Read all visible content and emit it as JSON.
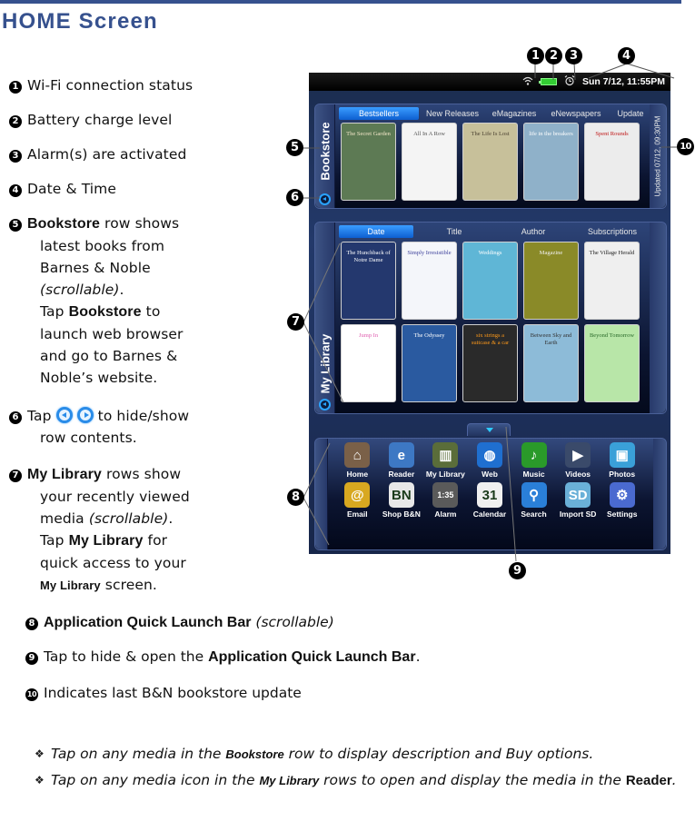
{
  "page": {
    "title": "HOME Screen"
  },
  "legend": [
    {
      "num": "1",
      "text": "Wi-Fi connection status"
    },
    {
      "num": "2",
      "text": "Battery charge level"
    },
    {
      "num": "3",
      "text": "Alarm(s) are activated"
    },
    {
      "num": "4",
      "text": "Date & Time"
    },
    {
      "num": "5",
      "bold": "Bookstore",
      "text": " row shows",
      "lines": [
        "latest books from",
        "Barnes & Noble"
      ],
      "italic": "(scrollable)",
      "after_italic": ".",
      "tap_prefix": "Tap ",
      "tap_bold": "Bookstore",
      "tap_suffix": " to",
      "tap_lines": [
        "launch web browser",
        "and go to Barnes &",
        "Noble’s website."
      ]
    },
    {
      "num": "6",
      "prefix": "Tap ",
      "suffix": " to hide/show",
      "line2": "row contents.",
      "icons": [
        "collapse-left-icon",
        "expand-right-icon"
      ]
    },
    {
      "num": "7",
      "bold": "My Library",
      "text": " rows show",
      "line2": "your recently viewed",
      "line3_prefix": "media ",
      "line3_italic": "(scrollable)",
      "line3_suffix": ".",
      "tap_prefix": "Tap ",
      "tap_bold": "My Library",
      "tap_suffix": " for",
      "line5": "quick access to your",
      "line6_bold": "My Library",
      "line6_suffix": " screen."
    },
    {
      "num": "8",
      "bold": "Application Quick Launch Bar",
      "italic": " (scrollable)"
    },
    {
      "num": "9",
      "prefix": "Tap to hide & open the ",
      "bold": "Application Quick Launch Bar",
      "suffix": "."
    },
    {
      "num": "10",
      "text": "Indicates last B&N bookstore update"
    }
  ],
  "tips": [
    {
      "prefix": "Tap on any media in the ",
      "bold": "Bookstore",
      "suffix": " row to display description and Buy options."
    },
    {
      "prefix": "Tap on any media icon in the ",
      "bold": "My Library",
      "suffix": " rows to open and display the media in the ",
      "bold2": "Reader",
      "end": "."
    }
  ],
  "device": {
    "status_bar": {
      "icons": [
        "wifi-icon",
        "battery-icon",
        "alarm-icon"
      ],
      "datetime": "Sun 7/12, 11:55PM"
    },
    "bookstore": {
      "side_label": "Bookstore",
      "tabs": [
        "Bestsellers",
        "New Releases",
        "eMagazines",
        "eNewspapers",
        "Update"
      ],
      "active_tab": "Bestsellers",
      "updated_label": "Updated 07/12, 09:30PM",
      "covers": [
        {
          "title": "The Secret Garden",
          "bg": "#5d7a54",
          "fg": "#f3e6c8"
        },
        {
          "title": "All In A Row",
          "bg": "#f4f4f4",
          "fg": "#555555"
        },
        {
          "title": "The Life Is Lost",
          "bg": "#c7c09a",
          "fg": "#4a4030"
        },
        {
          "title": "life in the breakers",
          "bg": "#8fb1c9",
          "fg": "#ffffff"
        },
        {
          "title": "Spent Rounds",
          "bg": "#ececec",
          "fg": "#c01818"
        }
      ]
    },
    "library": {
      "side_label": "My Library",
      "tabs": [
        "Date",
        "Title",
        "Author",
        "Subscriptions"
      ],
      "active_tab": "Date",
      "row1": [
        {
          "title": "The Hunchback of Notre Dame",
          "bg": "#24386e",
          "fg": "#ffffff"
        },
        {
          "title": "Simply Irresistible",
          "bg": "#f4f6fa",
          "fg": "#3b3f9a"
        },
        {
          "title": "Weddings",
          "bg": "#5fb6d6",
          "fg": "#ffffff"
        },
        {
          "title": "Magazine",
          "bg": "#8a8a28",
          "fg": "#f0f0f0"
        },
        {
          "title": "The Village Herald",
          "bg": "#efefef",
          "fg": "#222222"
        }
      ],
      "row2": [
        {
          "title": "Jump In",
          "bg": "#ffffff",
          "fg": "#e060b0"
        },
        {
          "title": "The Odyssey",
          "bg": "#2a5aa0",
          "fg": "#ffffff"
        },
        {
          "title": "six strings a suitcase & a car",
          "bg": "#2a2a2a",
          "fg": "#ff9a1a"
        },
        {
          "title": "Between Sky and Earth",
          "bg": "#8dbbd8",
          "fg": "#333333"
        },
        {
          "title": "Beyond Tomorrow",
          "bg": "#b8e6a8",
          "fg": "#2a6a2a"
        }
      ]
    },
    "quick_launch": {
      "apps": [
        {
          "label": "Home",
          "icon": "home-icon",
          "glyph": "⌂",
          "color": "#7a6048"
        },
        {
          "label": "Reader",
          "icon": "reader-icon",
          "glyph": "e",
          "color": "#3d78c4"
        },
        {
          "label": "My Library",
          "icon": "library-icon",
          "glyph": "▥",
          "color": "#5a6d3a"
        },
        {
          "label": "Web",
          "icon": "globe-icon",
          "glyph": "◍",
          "color": "#1f6fd0"
        },
        {
          "label": "Music",
          "icon": "music-icon",
          "glyph": "♪",
          "color": "#2a9a2a"
        },
        {
          "label": "Videos",
          "icon": "clapper-icon",
          "glyph": "▶",
          "color": "#3a4a6a"
        },
        {
          "label": "Photos",
          "icon": "photos-icon",
          "glyph": "▣",
          "color": "#3aa0d8"
        },
        {
          "label": "Email",
          "icon": "email-icon",
          "glyph": "@",
          "color": "#d8a820"
        },
        {
          "label": "Shop B&N",
          "icon": "bn-shop-icon",
          "glyph": "BN",
          "color": "#e8e8e8"
        },
        {
          "label": "Alarm",
          "icon": "alarm-clock-icon",
          "glyph": "1:35",
          "color": "#5a5a5a"
        },
        {
          "label": "Calendar",
          "icon": "calendar-icon",
          "glyph": "31",
          "color": "#f0f0f0"
        },
        {
          "label": "Search",
          "icon": "search-icon",
          "glyph": "⚲",
          "color": "#2a7fd8"
        },
        {
          "label": "Import SD",
          "icon": "sd-card-icon",
          "glyph": "SD",
          "color": "#6ab0d8"
        },
        {
          "label": "Settings",
          "icon": "gear-icon",
          "glyph": "⚙",
          "color": "#4a6ad0"
        }
      ]
    }
  },
  "callouts": [
    "1",
    "2",
    "3",
    "4",
    "5",
    "6",
    "7",
    "8",
    "9",
    "10"
  ]
}
